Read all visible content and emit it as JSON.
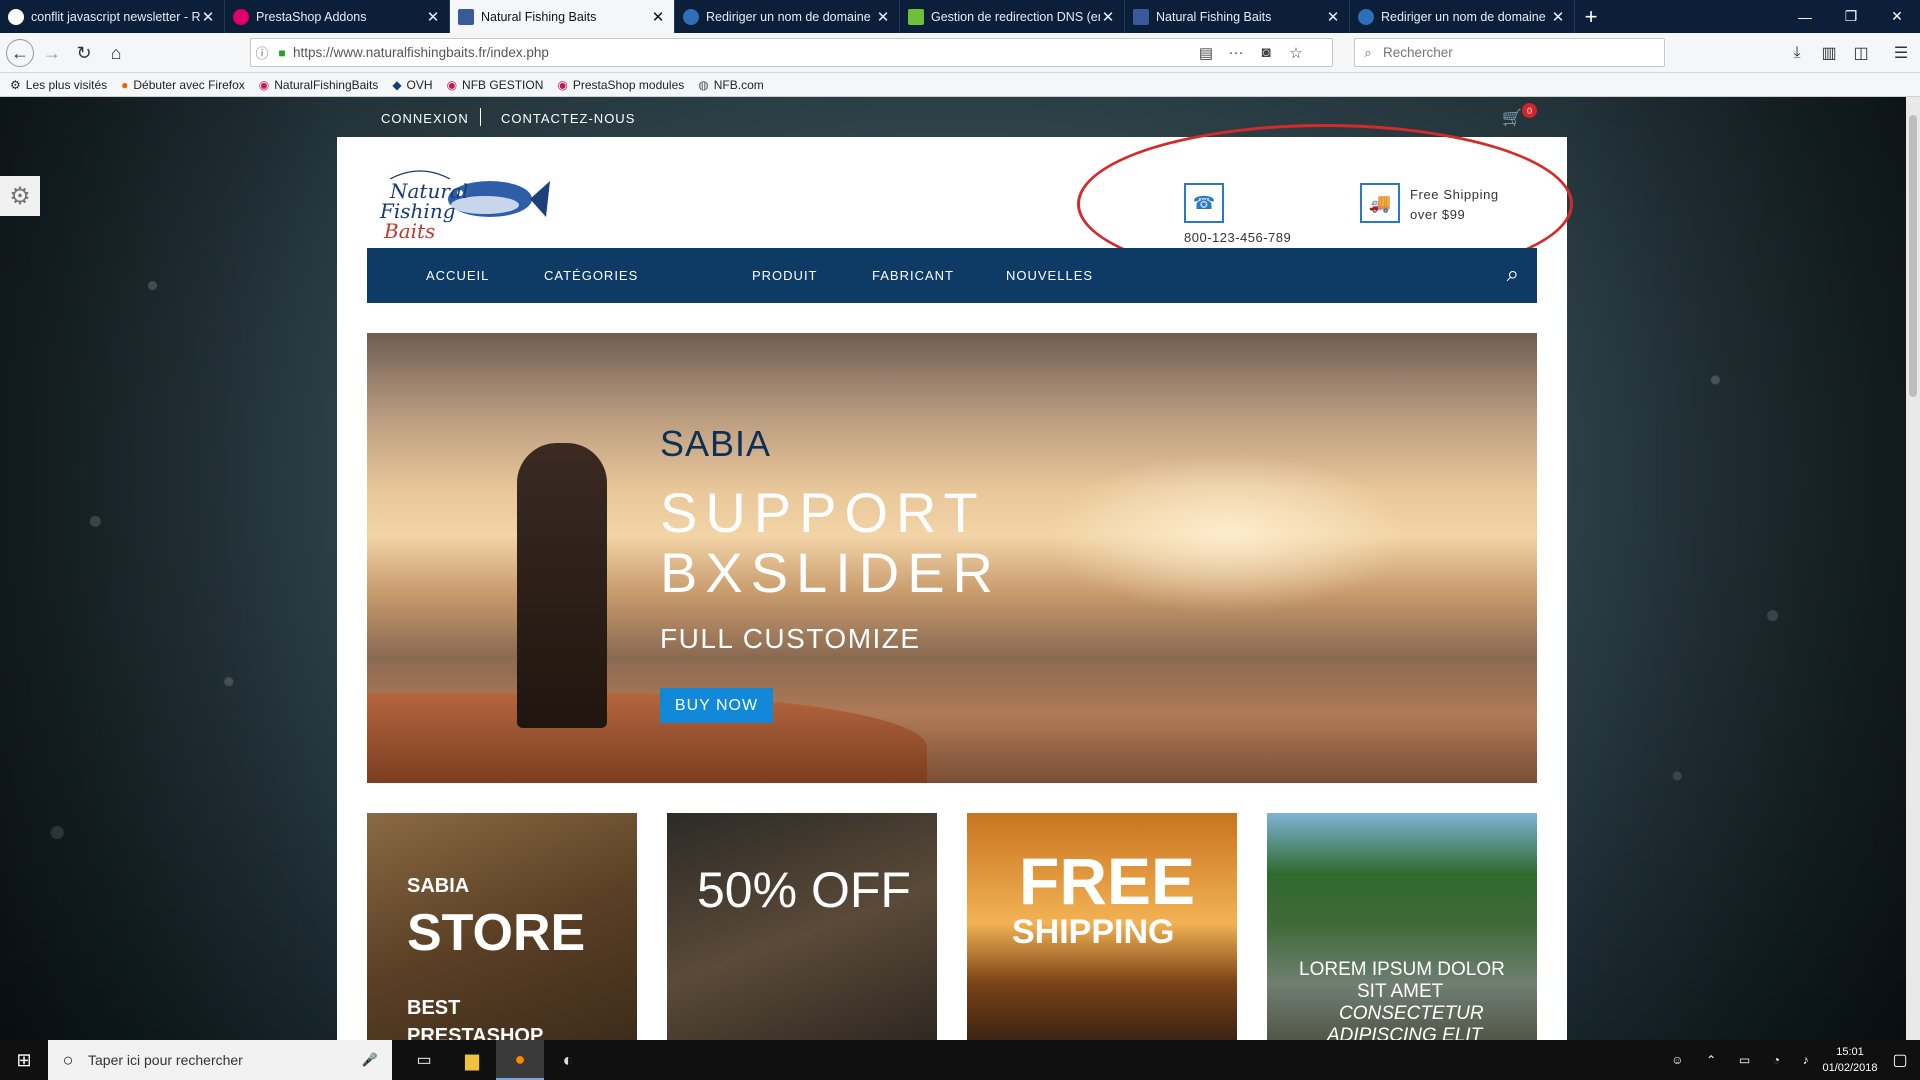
{
  "browser": {
    "tabs": [
      {
        "title": "conflit javascript newsletter - R",
        "color": "#ffffff",
        "active": false
      },
      {
        "title": "PrestaShop Addons",
        "color": "#df0067",
        "active": false
      },
      {
        "title": "Natural Fishing Baits",
        "color": "#3b5998",
        "active": true
      },
      {
        "title": "Rediriger un nom de domaine",
        "color": "#2f6fb7",
        "active": false
      },
      {
        "title": "Gestion de redirection DNS (en",
        "color": "#6fbf3a",
        "active": false
      },
      {
        "title": "Natural Fishing Baits",
        "color": "#3b5998",
        "active": false
      },
      {
        "title": "Rediriger un nom de domaine",
        "color": "#2f6fb7",
        "active": false
      }
    ],
    "url": "https://www.naturalfishingbaits.fr/index.php",
    "search_placeholder": "Rechercher",
    "bookmarks": [
      {
        "label": "Les plus visités",
        "icon": "gear-icon"
      },
      {
        "label": "Débuter avec Firefox",
        "icon": "firefox-icon"
      },
      {
        "label": "NaturalFishingBaits",
        "icon": "prestashop-icon"
      },
      {
        "label": "OVH",
        "icon": "ovh-icon"
      },
      {
        "label": "NFB GESTION",
        "icon": "prestashop-icon"
      },
      {
        "label": "PrestaShop modules",
        "icon": "prestashop-icon"
      },
      {
        "label": "NFB.com",
        "icon": "globe-icon"
      }
    ]
  },
  "site": {
    "top": {
      "login": "CONNEXION",
      "contact": "CONTACTEZ-NOUS",
      "cart_count": "0"
    },
    "logo": {
      "line1": "Natural",
      "line2": "Fishing",
      "line3": "Baits"
    },
    "phone": "800-123-456-789",
    "shipping": {
      "line1": "Free Shipping",
      "line2": "over $99"
    },
    "nav": [
      "ACCUEIL",
      "CATÉGORIES",
      "PRODUIT",
      "FABRICANT",
      "NOUVELLES"
    ],
    "hero": {
      "subtitle": "SABIA",
      "title_line1": "SUPPORT",
      "title_line2": "BXSLIDER",
      "tagline": "FULL CUSTOMIZE",
      "button": "BUY NOW"
    },
    "banners": [
      {
        "small": "SABIA",
        "big": "STORE",
        "line3": "BEST",
        "line4": "PRESTASHOP"
      },
      {
        "text": "50% OFF"
      },
      {
        "line1": "FREE",
        "line2": "SHIPPING"
      },
      {
        "line1": "LOREM IPSUM DOLOR",
        "line2": "SIT AMET",
        "line3": "CONSECTETUR",
        "line4": "ADIPISCING ELIT"
      }
    ]
  },
  "taskbar": {
    "search_placeholder": "Taper ici pour rechercher",
    "time": "15:01",
    "date": "01/02/2018"
  },
  "colors": {
    "nav_bg": "#0d3b66",
    "accent_blue": "#2b78c4",
    "button_blue": "#1189d8",
    "annotation_red": "#d42a2a",
    "cart_badge": "#d6232a"
  }
}
